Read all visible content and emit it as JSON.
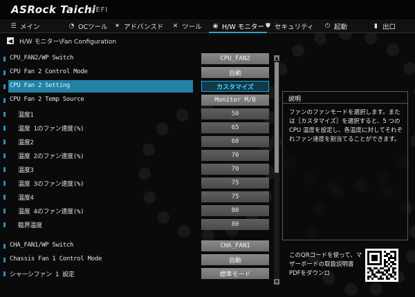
{
  "brand": {
    "logo": "ASRock Taichi",
    "uefi": "UEFI"
  },
  "nav": {
    "tabs": [
      {
        "label": "メイン",
        "icon": "list-icon"
      },
      {
        "label": "OCツール",
        "icon": "speedometer-icon"
      },
      {
        "label": "アドバンスド",
        "icon": "star-icon"
      },
      {
        "label": "ツール",
        "icon": "wrench-icon"
      },
      {
        "label": "H/W モニター",
        "icon": "monitor-icon",
        "active": true
      },
      {
        "label": "セキュリティ",
        "icon": "shield-icon"
      },
      {
        "label": "起動",
        "icon": "power-icon"
      },
      {
        "label": "出口",
        "icon": "exit-icon"
      }
    ]
  },
  "breadcrumb": {
    "text": "H/W モニター\\Fan Configuration"
  },
  "settings": [
    {
      "label": "CPU_FAN2/WP Switch",
      "value": "CPU_FAN2",
      "indent": false
    },
    {
      "label": "CPU Fan 2 Control Mode",
      "value": "自動",
      "indent": false
    },
    {
      "label": "CPU Fan 2 Setting",
      "value": "カスタマイズ",
      "indent": false,
      "selected": true
    },
    {
      "label": "CPU Fan 2 Temp Source",
      "value": "Monitor M/B",
      "indent": false
    },
    {
      "label": "温度1",
      "value": "50",
      "indent": true,
      "dim": true
    },
    {
      "label": "温度 1のファン速度(%)",
      "value": "65",
      "indent": true,
      "dim": true
    },
    {
      "label": "温度2",
      "value": "60",
      "indent": true,
      "dim": true
    },
    {
      "label": "温度 2のファン速度(%)",
      "value": "70",
      "indent": true,
      "dim": true
    },
    {
      "label": "温度3",
      "value": "70",
      "indent": true,
      "dim": true
    },
    {
      "label": "温度 3のファン速度(%)",
      "value": "75",
      "indent": true,
      "dim": true
    },
    {
      "label": "温度4",
      "value": "75",
      "indent": true,
      "dim": true
    },
    {
      "label": "温度 4のファン速度(%)",
      "value": "80",
      "indent": true,
      "dim": true
    },
    {
      "label": "臨界温度",
      "value": "80",
      "indent": true,
      "dim": true
    },
    {
      "label": "CHA_FAN1/WP Switch",
      "value": "CHA_FAN1",
      "indent": false,
      "gap": true
    },
    {
      "label": "Chassis Fan 1 Control Mode",
      "value": "自動",
      "indent": false
    },
    {
      "label": "シャーシファン 1 設定",
      "value": "標準モード",
      "indent": false
    }
  ],
  "description": {
    "title": "説明",
    "text": "ファンのファンモードを選択します。または［カスタマイズ］を選択すると、5 つの CPU 温度を設定し、各温度に対してそれぞれファン速度を割当てることができます。"
  },
  "qr": {
    "text": "このQRコードを使って、マザーボードの取扱説明書PDFをダウンロ"
  },
  "colors": {
    "accent": "#29a8d6",
    "selected_bar": "#2896c2"
  }
}
